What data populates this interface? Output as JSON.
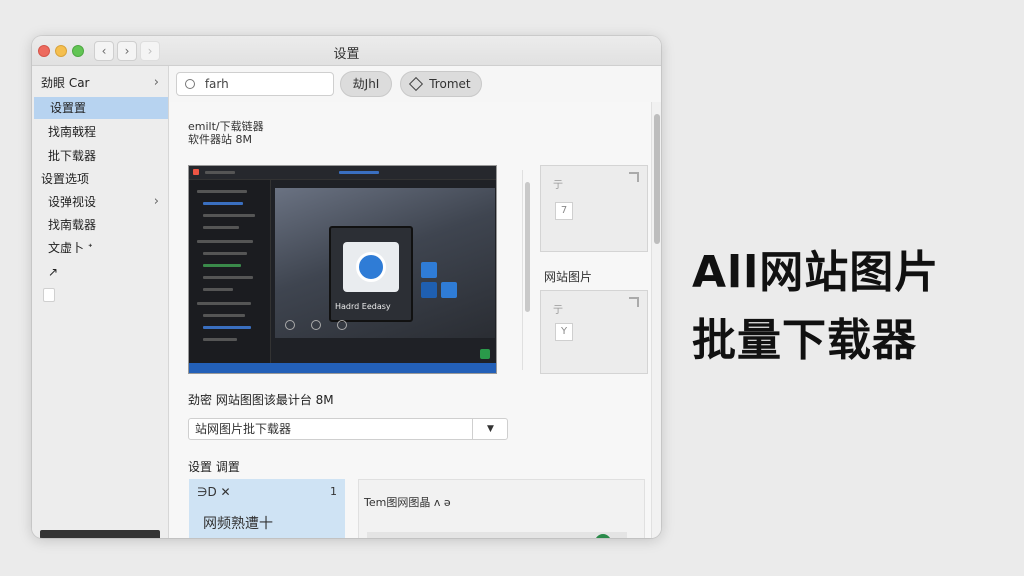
{
  "window": {
    "title": "设置",
    "nav": {
      "back": "‹",
      "forward": "›",
      "forward_disabled": "›"
    }
  },
  "sidebar": {
    "items": [
      {
        "label": "劲眼 Car",
        "chevron": "›"
      },
      {
        "label": "设置置"
      },
      {
        "label": "找南戟程"
      },
      {
        "label": "批下载器"
      },
      {
        "label": "设置选项"
      },
      {
        "label": "设弹视设",
        "chevron": "›"
      },
      {
        "label": "找南载器"
      },
      {
        "label": "文虚卜 ᐩ"
      },
      {
        "label": "↗"
      }
    ]
  },
  "toolbar": {
    "search_value": "farh",
    "pill_1": "劫JhI",
    "pill_2": "Tromet"
  },
  "content": {
    "intro_line_1": "emilt/下载链器",
    "intro_line_2": "软件器站 8M",
    "preview_caption": "Hadrd  Eedasy",
    "side_label": "网站图片",
    "thumb_glyph_top": "亍",
    "thumb_glyph_bottom": "亍",
    "thumb_icon_top": "7",
    "thumb_icon_bottom": "Y",
    "path_label": "劲密  网站图图该最计台 8M",
    "select_value": "站网图片批下载器",
    "select_arrow": "▼",
    "settings_header": "设置 调置",
    "card_top_left": "∋D ✕",
    "card_top_right": "1",
    "card_body": "网频熟遭十",
    "panel_label": "Tem图网图晶 ʌ ə"
  },
  "headline": {
    "line_1": "All网站图片",
    "line_2": "批量下载器"
  },
  "colors": {
    "accent_selected": "#b7d3f0",
    "card_blue": "#cfe3f4",
    "preview_blue": "#2f7cd6"
  }
}
